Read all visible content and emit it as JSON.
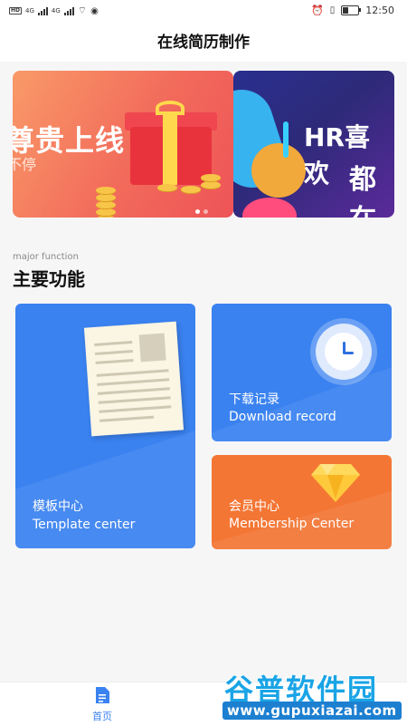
{
  "status_bar": {
    "network_left": "HD",
    "network_right": "4G",
    "network_g": "4G",
    "time": "12:50"
  },
  "header": {
    "title": "在线简历制作"
  },
  "banners": [
    {
      "title": "尊贵上线",
      "subtitle": "不停"
    },
    {
      "title": "HR喜欢",
      "subtitle": "都在"
    }
  ],
  "carousel": {
    "count": 2,
    "active_index": 0
  },
  "section": {
    "label_en": "major function",
    "label_zh": "主要功能"
  },
  "cards": {
    "template": {
      "label_zh": "模板中心",
      "label_en": "Template center",
      "icon": "resume-document-icon"
    },
    "download": {
      "label_zh": "下载记录",
      "label_en": "Download record",
      "icon": "clock-icon"
    },
    "member": {
      "label_zh": "会员中心",
      "label_en": "Membership Center",
      "icon": "diamond-icon"
    }
  },
  "tabbar": {
    "home_label": "首页",
    "home_icon": "document-icon"
  },
  "watermark": {
    "name": "谷普软件园",
    "url": "www.gupuxiazai.com"
  },
  "colors": {
    "primary_blue": "#3a82f0",
    "orange": "#f47634",
    "watermark_blue": "#19a4e6"
  }
}
